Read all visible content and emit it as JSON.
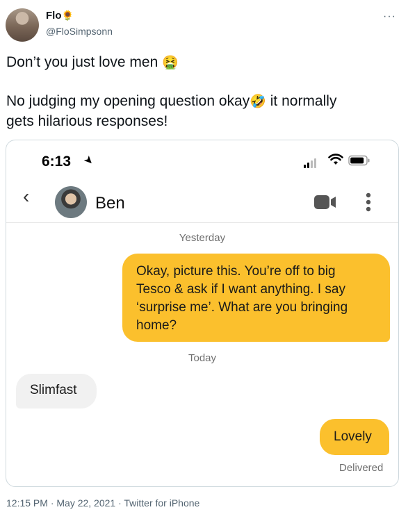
{
  "tweet": {
    "display_name": "Flo",
    "name_emoji": "🌻",
    "handle": "@FloSimpsonn",
    "more_icon": "more-icon",
    "line1": "Don’t you just love men",
    "line1_emoji": "🤮",
    "line2": "No judging my opening question okay",
    "line2_emoji": "🤣",
    "line2_tail": "it normally",
    "line3": "gets hilarious responses!",
    "footer": "12:15 PM · May 22, 2021 · Twitter for iPhone"
  },
  "phone": {
    "status_time": "6:13",
    "contact_name": "Ben",
    "messages": [
      {
        "divider": "Yesterday"
      },
      {
        "direction": "out",
        "lines": [
          "Okay, picture this. You’re off to big",
          "Tesco & ask if I want anything. I say",
          "‘surprise me’. What are you bringing",
          "home?"
        ]
      },
      {
        "divider": "Today"
      },
      {
        "direction": "in",
        "text": "Slimfast"
      },
      {
        "direction": "out",
        "text": "Lovely",
        "status": "Delivered"
      }
    ],
    "colors": {
      "outgoing_bubble": "#fbc02d",
      "incoming_bubble": "#f1f1f1"
    }
  }
}
